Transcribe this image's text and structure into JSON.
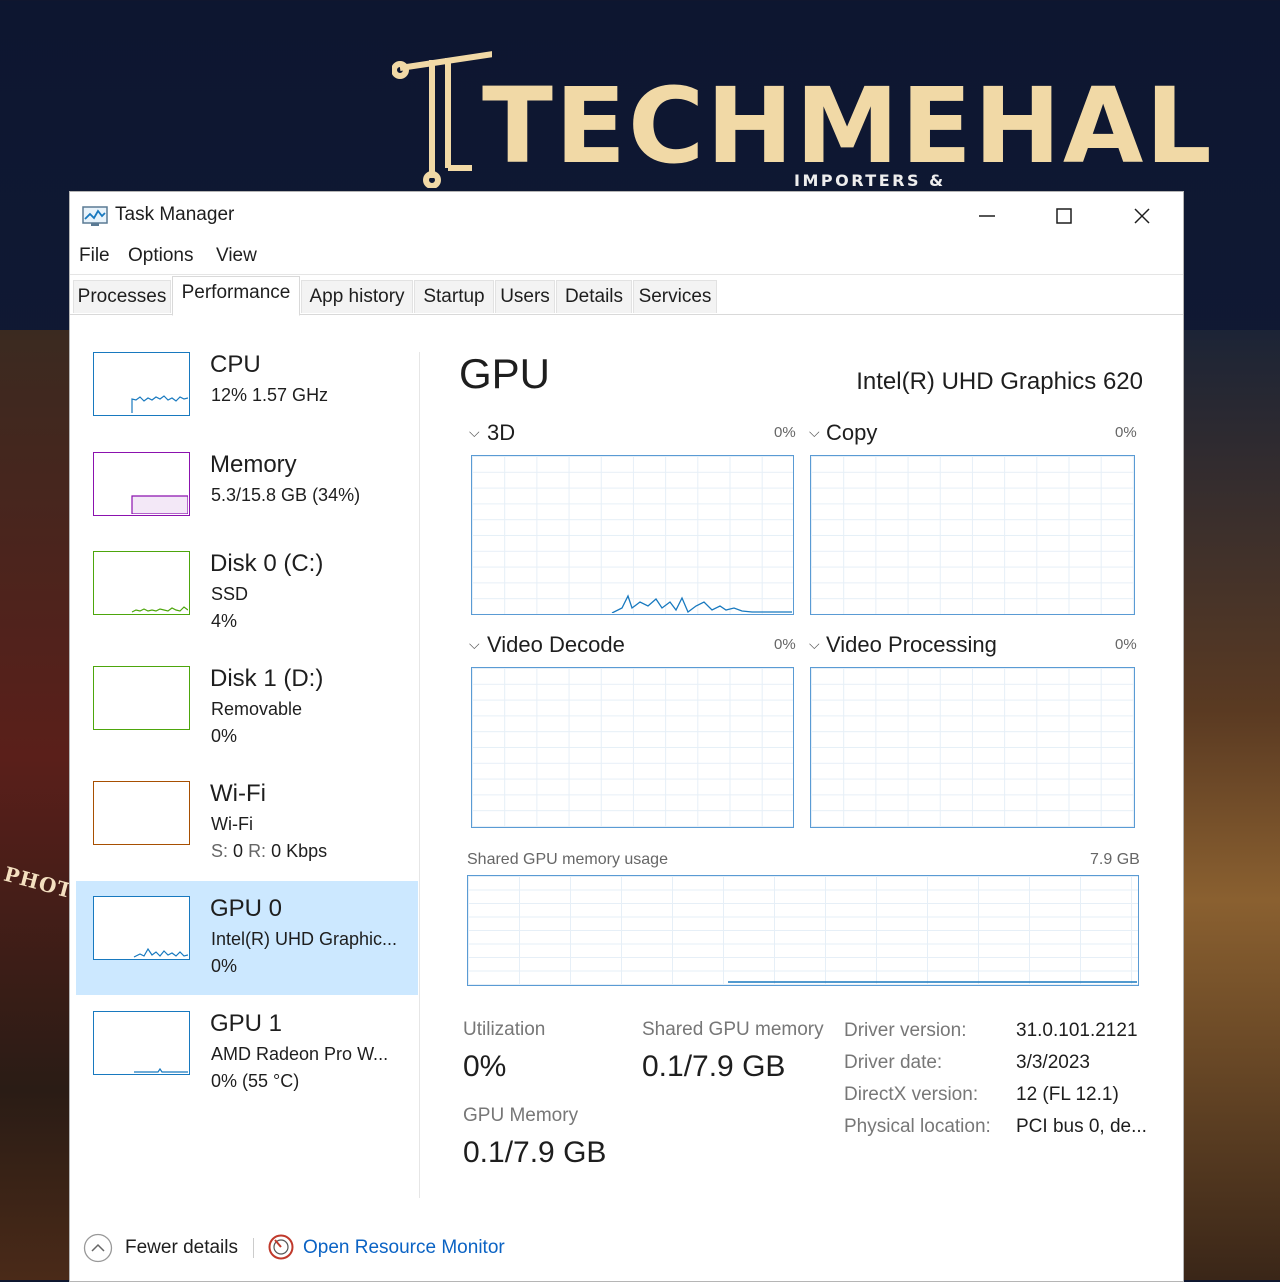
{
  "logo": {
    "main": "TECHMEHAL",
    "tagline": "IMPORTERS & WHOLESALERS"
  },
  "background": {
    "sign_text": "PHOTO"
  },
  "window": {
    "title": "Task Manager",
    "controls": {
      "minimize": "—",
      "maximize": "☐",
      "close": "✕"
    }
  },
  "menu": [
    "File",
    "Options",
    "View"
  ],
  "tabs": [
    "Processes",
    "Performance",
    "App history",
    "Startup",
    "Users",
    "Details",
    "Services"
  ],
  "active_tab": "Performance",
  "sidebar": [
    {
      "name": "CPU",
      "line2": "12%  1.57 GHz",
      "line3": "",
      "color": "#1879bf"
    },
    {
      "name": "Memory",
      "line2": "5.3/15.8 GB (34%)",
      "line3": "",
      "color": "#8b12ae"
    },
    {
      "name": "Disk 0 (C:)",
      "line2": "SSD",
      "line3": "4%",
      "color": "#4da60c"
    },
    {
      "name": "Disk 1 (D:)",
      "line2": "Removable",
      "line3": "0%",
      "color": "#4da60c"
    },
    {
      "name": "Wi-Fi",
      "line2": "Wi-Fi",
      "line3_prefix_s": "S:",
      "line3_s": "0",
      "line3_prefix_r": "R:",
      "line3_r": "0 Kbps",
      "color": "#a74f01"
    },
    {
      "name": "GPU 0",
      "line2": "Intel(R) UHD Graphic...",
      "line3": "0%",
      "color": "#1879bf",
      "selected": true
    },
    {
      "name": "GPU 1",
      "line2": "AMD Radeon Pro W...",
      "line3": "0%  (55 °C)",
      "color": "#1879bf"
    }
  ],
  "gpu": {
    "title": "GPU",
    "model": "Intel(R) UHD Graphics 620",
    "engines": [
      {
        "label": "3D",
        "pct": "0%"
      },
      {
        "label": "Copy",
        "pct": "0%"
      },
      {
        "label": "Video Decode",
        "pct": "0%"
      },
      {
        "label": "Video Processing",
        "pct": "0%"
      }
    ],
    "shared_label": "Shared GPU memory usage",
    "shared_max": "7.9 GB",
    "stats": {
      "utilization_label": "Utilization",
      "utilization_value": "0%",
      "shared_mem_label": "Shared GPU memory",
      "shared_mem_value": "0.1/7.9 GB",
      "gpu_mem_label": "GPU Memory",
      "gpu_mem_value": "0.1/7.9 GB"
    },
    "info": [
      {
        "label": "Driver version:",
        "value": "31.0.101.2121"
      },
      {
        "label": "Driver date:",
        "value": "3/3/2023"
      },
      {
        "label": "DirectX version:",
        "value": "12 (FL 12.1)"
      },
      {
        "label": "Physical location:",
        "value": "PCI bus 0, de..."
      }
    ]
  },
  "footer": {
    "fewer_details": "Fewer details",
    "open_monitor": "Open Resource Monitor"
  },
  "colors": {
    "accent_blue": "#1879bf",
    "graph_border": "#5a9bd4",
    "selection": "#cce8ff",
    "link": "#0b63c4",
    "logo_gold": "#f1d9a6"
  }
}
